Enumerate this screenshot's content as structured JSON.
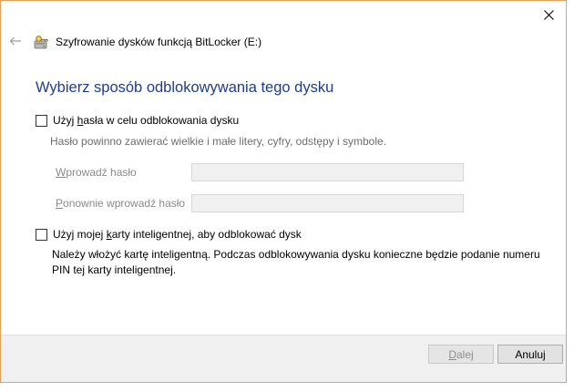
{
  "window": {
    "title": "Szyfrowanie dysków funkcją BitLocker (E:)",
    "close_glyph": "✕",
    "back_glyph": "←"
  },
  "main": {
    "heading": "Wybierz sposób odblokowywania tego dysku",
    "password_option": {
      "label_pre": "Użyj ",
      "label_ul": "h",
      "label_post": "asła w celu odblokowania dysku",
      "hint": "Hasło powinno zawierać wielkie i małe litery, cyfry, odstępy i symbole.",
      "enter_label_ul": "W",
      "enter_label_rest": "prowadź hasło",
      "reenter_label_ul": "P",
      "reenter_label_rest": "onownie wprowadź hasło",
      "enter_value": "",
      "reenter_value": ""
    },
    "smartcard_option": {
      "label_pre": "Użyj mojej ",
      "label_ul": "k",
      "label_post": "arty inteligentnej, aby odblokować dysk",
      "description": "Należy włożyć kartę inteligentną. Podczas odblokowywania dysku konieczne będzie podanie numeru PIN tej karty inteligentnej."
    }
  },
  "footer": {
    "next_ul": "D",
    "next_rest": "alej",
    "cancel_label": "Anuluj"
  },
  "colors": {
    "heading": "#1e3d8c",
    "window_border": "#e3a25a",
    "footer_bg": "#f0f0f0"
  },
  "icons": {
    "title_icon": "bitlocker-key-drive-icon"
  }
}
